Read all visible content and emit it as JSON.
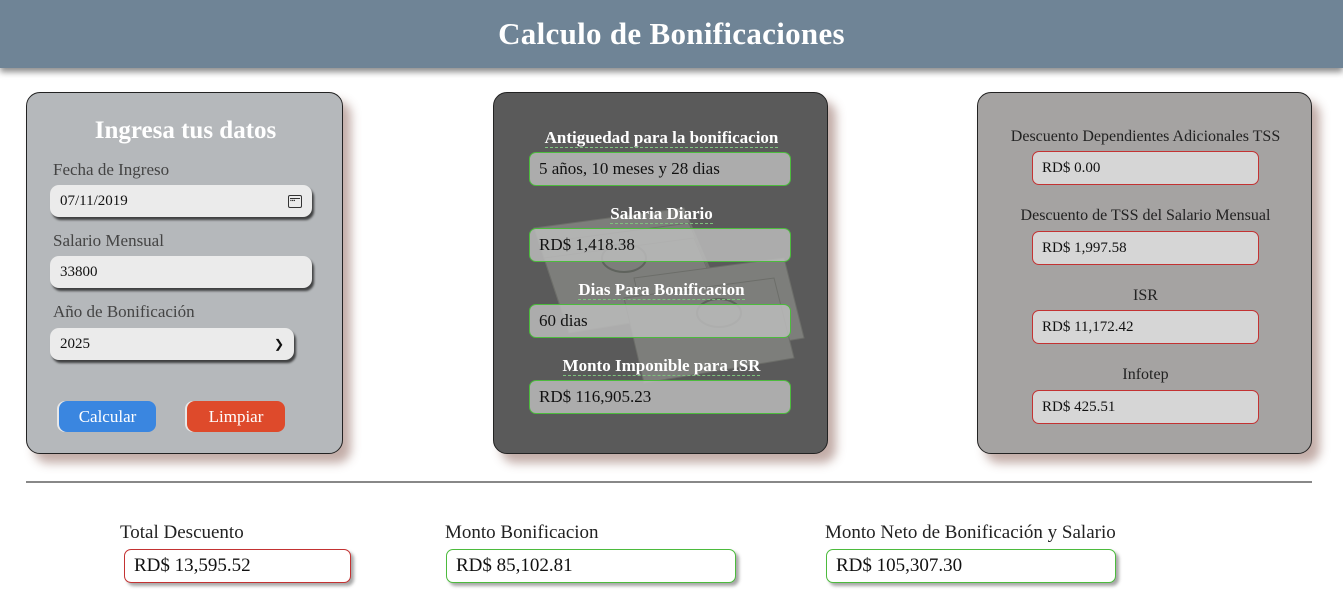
{
  "header": {
    "title": "Calculo de Bonificaciones"
  },
  "form": {
    "title": "Ingresa tus datos",
    "fecha_label": "Fecha de Ingreso",
    "fecha_value": "07/11/2019",
    "salario_label": "Salario Mensual",
    "salario_value": "33800",
    "anio_label": "Año de Bonificación",
    "anio_value": "2025",
    "calcular_label": "Calcular",
    "limpiar_label": "Limpiar"
  },
  "results": {
    "antiguedad_label": "Antiguedad para la bonificacion",
    "antiguedad_value": "5 años, 10 meses y 28 dias",
    "salario_diario_label": "Salaria Diario",
    "salario_diario_value": "RD$ 1,418.38",
    "dias_label": "Dias Para Bonificacion",
    "dias_value": "60 dias",
    "monto_imponible_label": "Monto Imponible para ISR",
    "monto_imponible_value": "RD$ 116,905.23"
  },
  "deductions": {
    "dependientes_label": "Descuento Dependientes Adicionales TSS",
    "dependientes_value": "RD$ 0.00",
    "tss_label": "Descuento de TSS del Salario Mensual",
    "tss_value": "RD$ 1,997.58",
    "isr_label": "ISR",
    "isr_value": "RD$ 11,172.42",
    "infotep_label": "Infotep",
    "infotep_value": "RD$ 425.51"
  },
  "totals": {
    "total_descuento_label": "Total Descuento",
    "total_descuento_value": "RD$ 13,595.52",
    "monto_bonificacion_label": "Monto Bonificacion",
    "monto_bonificacion_value": "RD$ 85,102.81",
    "monto_neto_label": "Monto Neto de Bonificación y Salario",
    "monto_neto_value": "RD$ 105,307.30"
  },
  "colors": {
    "header_bg": "#6f8496",
    "calcular_button": "#3a86e0",
    "limpiar_button": "#de4a2b",
    "positive_border": "#4cbb3d",
    "negative_border": "#c33232"
  }
}
